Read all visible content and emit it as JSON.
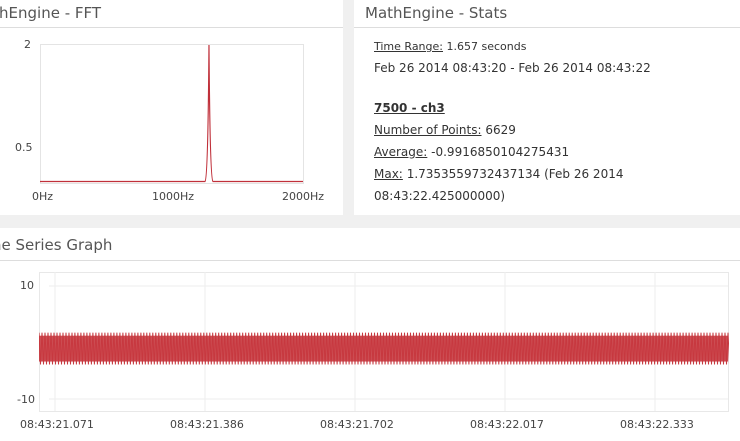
{
  "fft_panel": {
    "title": "MathEngine - FFT"
  },
  "stats_panel": {
    "title": "MathEngine - Stats",
    "time_range_label": "Time Range:",
    "time_range_value": "1.657 seconds",
    "date_range": "Feb 26 2014 08:43:20 - Feb 26 2014 08:43:22",
    "channel": "7500 - ch3",
    "points_label": "Number of Points:",
    "points_value": "6629",
    "avg_label": "Average:",
    "avg_value": "-0.9916850104275431",
    "max_label": "Max:",
    "max_value": "1.7353559732437134 (Feb 26 2014",
    "max_cont": "08:43:22.425000000)"
  },
  "ts_panel": {
    "title": "Time Series Graph"
  },
  "chart_data": [
    {
      "type": "line",
      "title": "MathEngine - FFT",
      "x_ticks": [
        "0Hz",
        "1000Hz",
        "2000Hz"
      ],
      "y_ticks": [
        "2",
        "0.5"
      ],
      "xlim": [
        0,
        2000
      ],
      "peak_hz": 1285,
      "peak_value": 2,
      "baseline": 0.02,
      "color": "#c0303a"
    },
    {
      "type": "line",
      "title": "Time Series Graph",
      "x_ticks": [
        "08:43:21.071",
        "08:43:21.386",
        "08:43:21.702",
        "08:43:22.017",
        "08:43:22.333"
      ],
      "y_ticks": [
        "10",
        "-10"
      ],
      "ylim": [
        -10,
        10
      ],
      "signal_max": 1.735,
      "signal_min": -3.9,
      "cycles": 230,
      "color": "#c7393f"
    }
  ]
}
